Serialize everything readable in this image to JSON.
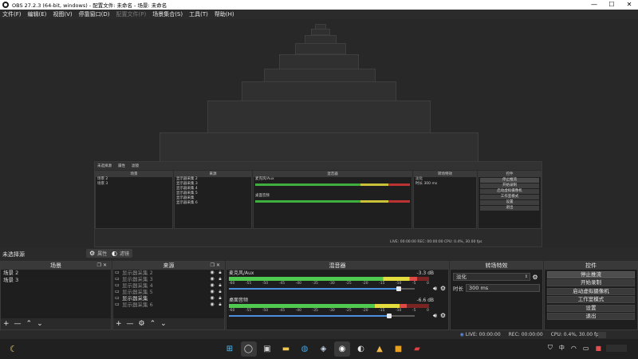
{
  "window": {
    "title": "OBS 27.2.3 (64-bit, windows) - 配置文件: 未命名 - 场景: 未命名",
    "controls": [
      "—",
      "☐",
      "✕"
    ]
  },
  "menu": [
    {
      "label": "文件(F)",
      "enabled": true
    },
    {
      "label": "编辑(E)",
      "enabled": true
    },
    {
      "label": "视图(V)",
      "enabled": true
    },
    {
      "label": "停靠窗口(D)",
      "enabled": true
    },
    {
      "label": "配置文件(P)",
      "enabled": false
    },
    {
      "label": "场景集合(S)",
      "enabled": true
    },
    {
      "label": "工具(T)",
      "enabled": true
    },
    {
      "label": "帮助(H)",
      "enabled": true
    }
  ],
  "mini_preview": {
    "header_scene": "未选择源",
    "properties": "属性",
    "filters": "滤镜",
    "scenes_title": "场景",
    "scenes": [
      "场景 2",
      "场景 3"
    ],
    "sources_title": "来源",
    "sources": [
      "显示器采集 2",
      "显示器采集 3",
      "显示器采集 4",
      "显示器采集 5",
      "显示器采集",
      "显示器采集 6"
    ],
    "mixer_title": "混音器",
    "mixer_tracks": [
      "麦克风/Aux",
      "桌面音频"
    ],
    "transitions_title": "转场特效",
    "transition": "淡化",
    "duration_label": "时长",
    "duration": "300 ms",
    "controls_title": "控件",
    "controls": [
      "停止推流",
      "开始录制",
      "启动虚拟摄像机",
      "工作室模式",
      "设置",
      "退出"
    ],
    "status": "LIVE: 00:00:00   REC: 00:00:00   CPU: 0.4%, 30.00 fps"
  },
  "no_source": "未选择源",
  "properties_button": "属性",
  "filters_button": "滤镜",
  "scenes": {
    "title": "场景",
    "items": [
      "场景 2",
      "场景 3"
    ]
  },
  "sources": {
    "title": "来源",
    "items": [
      {
        "name": "显示器采集 2",
        "visible": true
      },
      {
        "name": "显示器采集 3",
        "visible": true
      },
      {
        "name": "显示器采集 4",
        "visible": true
      },
      {
        "name": "显示器采集 5",
        "visible": true
      },
      {
        "name": "显示器采集",
        "visible": true
      },
      {
        "name": "显示器采集 6",
        "visible": true
      }
    ]
  },
  "mixer": {
    "title": "混音器",
    "scale": [
      "-60",
      "-55",
      "-50",
      "-45",
      "-40",
      "-35",
      "-30",
      "-25",
      "-20",
      "-15",
      "-10",
      "-5",
      "0"
    ],
    "tracks": [
      {
        "name": "麦克风/Aux",
        "db": "-3.3 dB",
        "level": 0.94,
        "volume": 0.9
      },
      {
        "name": "桌面音频",
        "db": "-6.6 dB",
        "level": 0.89,
        "volume": 0.85
      }
    ]
  },
  "transitions": {
    "title": "转场特效",
    "selected": "淡化",
    "duration_label": "时长",
    "duration": "300 ms"
  },
  "controls": {
    "title": "控件",
    "buttons": [
      "停止推流",
      "开始录制",
      "启动虚拟摄像机",
      "工作室模式",
      "设置",
      "退出"
    ]
  },
  "status": {
    "live": "LIVE: 00:00:00",
    "rec": "REC: 00:00:00",
    "cpu": "CPU: 0.4%, 30.00 fps"
  },
  "taskbar": {
    "apps": [
      "windows-start",
      "search",
      "task-view",
      "file-explorer",
      "edge",
      "steam",
      "obs",
      "app-8",
      "app-9",
      "app-10",
      "app-11"
    ]
  },
  "colors": {
    "meter_green": "#4fc94f",
    "meter_yellow": "#e2dc3f",
    "meter_red": "#e04848",
    "slider_blue": "#4a8fe0"
  }
}
